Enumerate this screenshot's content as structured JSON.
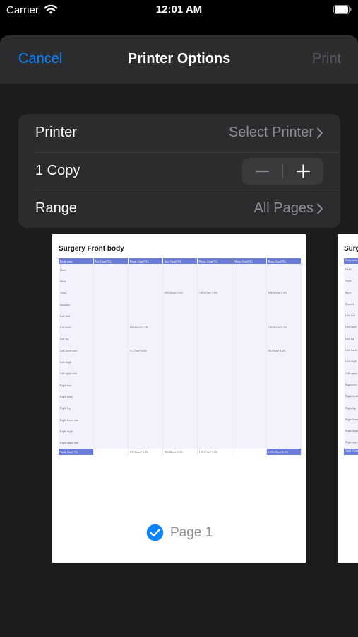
{
  "status_bar": {
    "carrier": "Carrier",
    "time": "12:01 AM"
  },
  "nav": {
    "cancel": "Cancel",
    "title": "Printer Options",
    "print": "Print"
  },
  "options": {
    "printer": {
      "label": "Printer",
      "value": "Select Printer"
    },
    "copies": {
      "label": "1 Copy"
    },
    "range": {
      "label": "Range",
      "value": "All Pages"
    }
  },
  "preview": {
    "title": "Surgery Front body",
    "columns": [
      "Body zone",
      "Mn, Gym² %]",
      "Norm, Gym² %]",
      "Acc, Gym² %]",
      "Prevn, Gym² %]",
      "Offset, Gym² %]",
      "Bore, Gym² %]"
    ],
    "rows": [
      [
        "Head",
        "",
        "",
        "",
        "",
        "",
        ""
      ],
      [
        "Neck",
        "",
        "",
        "",
        "",
        "",
        ""
      ],
      [
        "Torso",
        "",
        "",
        "965.42cm² 3.3%",
        "109.67cm² 1.0%",
        "",
        "936.45cm² 4.3%"
      ],
      [
        "Shoulder",
        "",
        "",
        "",
        "",
        "",
        ""
      ],
      [
        "Left foot",
        "",
        "",
        "",
        "",
        "",
        ""
      ],
      [
        "Left hand",
        "",
        "169.84cm² 0.7%",
        "",
        "",
        "",
        "145.67cm² 0.7%"
      ],
      [
        "Left leg",
        "",
        "",
        "",
        "",
        "",
        ""
      ],
      [
        "Left lower arm",
        "",
        "97.75cm² 0.6%",
        "",
        "",
        "",
        "96.93cm² 0.6%"
      ],
      [
        "Left thigh",
        "",
        "",
        "",
        "",
        "",
        ""
      ],
      [
        "Left upper arm",
        "",
        "",
        "",
        "",
        "",
        ""
      ],
      [
        "Right foot",
        "",
        "",
        "",
        "",
        "",
        ""
      ],
      [
        "Right hand",
        "",
        "",
        "",
        "",
        "",
        ""
      ],
      [
        "Right leg",
        "",
        "",
        "",
        "",
        "",
        ""
      ],
      [
        "Right lower arm",
        "",
        "",
        "",
        "",
        "",
        ""
      ],
      [
        "Right thigh",
        "",
        "",
        "",
        "",
        "",
        ""
      ],
      [
        "Right upper arm",
        "",
        "",
        "",
        "",
        "",
        ""
      ]
    ],
    "total": [
      "Total, Gym² %]",
      "",
      "109.84cm² 3.3%",
      "965.42cm² 3.3%",
      "109.67cm² 1.0%",
      "",
      "1290.96cm² 6.3%"
    ],
    "page_label": "Page 1"
  },
  "preview2": {
    "title": "Surg",
    "header": "Body zone",
    "rows": [
      "Head",
      "Neck",
      "Back",
      "Buttock",
      "Left foot",
      "Left hand",
      "Left leg",
      "Left lower arm",
      "Left thigh",
      "Left upper arm",
      "Right foot",
      "Right hand",
      "Right leg",
      "Right lower arm",
      "Right thigh",
      "Right upper arm"
    ],
    "total": "Total, Gym²"
  },
  "colors": {
    "accent": "#0a84ff",
    "sheet": "#1c1c1e",
    "card": "#2c2c2e",
    "table_header": "#6b7bd8",
    "table_cell": "#f2f2fc"
  },
  "icons": {
    "wifi": "wifi-icon",
    "battery": "battery-icon",
    "chevron": "chevron-right-icon",
    "minus": "minus-icon",
    "plus": "plus-icon",
    "check": "checkmark-circle-icon"
  }
}
